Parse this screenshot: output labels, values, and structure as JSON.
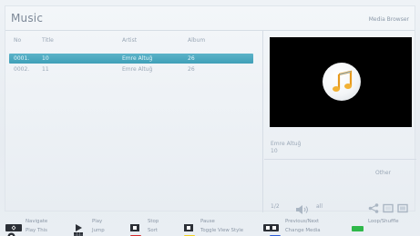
{
  "header": {
    "title": "Music",
    "subtitle": "Media Browser"
  },
  "columns": {
    "no": "No",
    "title": "Title",
    "artist": "Artist",
    "album": "Album"
  },
  "rows": [
    {
      "no": "0001.",
      "title": "10",
      "artist": "Emre Altuğ",
      "album": "26",
      "selected": true
    },
    {
      "no": "0002.",
      "title": "11",
      "artist": "Emre Altuğ",
      "album": "26",
      "selected": false
    }
  ],
  "preview": {
    "artist": "Emre Altuğ",
    "title": "10",
    "other_label": "Other",
    "count": "1/2",
    "volume_label": "all"
  },
  "footer": {
    "navigate": "Navigate",
    "play_this": "Play This",
    "play": "Play",
    "jump": "Jump",
    "stop": "Stop",
    "sort": "Sort",
    "pause": "Pause",
    "toggle_view_style": "Toggle View Style",
    "previous_next": "Previous/Next",
    "change_media": "Change Media",
    "loop_shuffle": "Loop/Shuffle"
  },
  "colors": {
    "selection": "#4aa8bf",
    "red": "#d62828",
    "yellow": "#f0d020",
    "blue": "#2a5bd7",
    "green": "#2fb84a"
  }
}
